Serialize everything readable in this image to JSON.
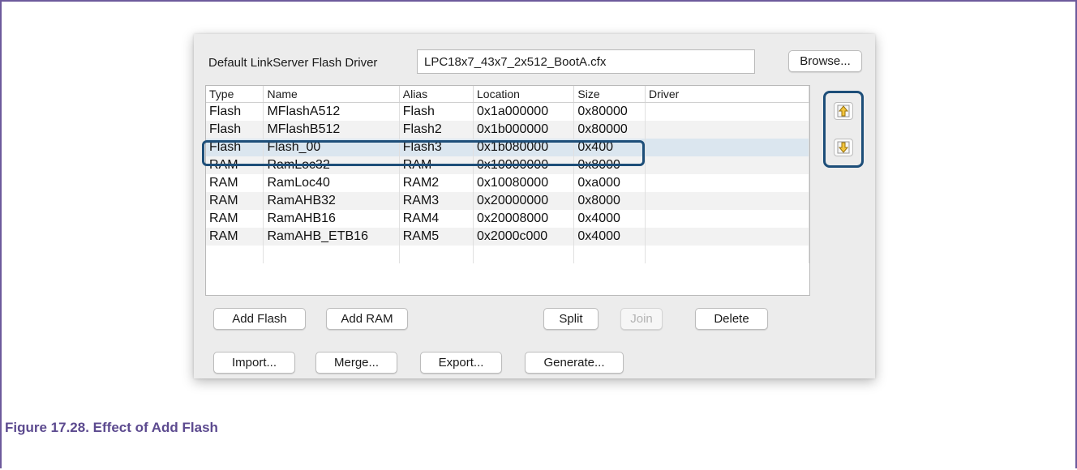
{
  "dialog": {
    "driver_label": "Default LinkServer Flash Driver",
    "driver_value": "LPC18x7_43x7_2x512_BootA.cfx",
    "browse_label": "Browse..."
  },
  "table": {
    "headers": [
      "Type",
      "Name",
      "Alias",
      "Location",
      "Size",
      "Driver"
    ],
    "rows": [
      {
        "type": "Flash",
        "name": "MFlashA512",
        "alias": "Flash",
        "location": "0x1a000000",
        "size": "0x80000",
        "driver": ""
      },
      {
        "type": "Flash",
        "name": "MFlashB512",
        "alias": "Flash2",
        "location": "0x1b000000",
        "size": "0x80000",
        "driver": ""
      },
      {
        "type": "Flash",
        "name": "Flash_00",
        "alias": "Flash3",
        "location": "0x1b080000",
        "size": "0x400",
        "driver": ""
      },
      {
        "type": "RAM",
        "name": "RamLoc32",
        "alias": "RAM",
        "location": "0x10000000",
        "size": "0x8000",
        "driver": ""
      },
      {
        "type": "RAM",
        "name": "RamLoc40",
        "alias": "RAM2",
        "location": "0x10080000",
        "size": "0xa000",
        "driver": ""
      },
      {
        "type": "RAM",
        "name": "RamAHB32",
        "alias": "RAM3",
        "location": "0x20000000",
        "size": "0x8000",
        "driver": ""
      },
      {
        "type": "RAM",
        "name": "RamAHB16",
        "alias": "RAM4",
        "location": "0x20008000",
        "size": "0x4000",
        "driver": ""
      },
      {
        "type": "RAM",
        "name": "RamAHB_ETB16",
        "alias": "RAM5",
        "location": "0x2000c000",
        "size": "0x4000",
        "driver": ""
      }
    ],
    "selected_row": 2
  },
  "buttons": {
    "add_flash": "Add Flash",
    "add_ram": "Add RAM",
    "split": "Split",
    "join": "Join",
    "delete": "Delete",
    "import": "Import...",
    "merge": "Merge...",
    "export": "Export...",
    "generate": "Generate..."
  },
  "icons": {
    "move_up": "arrow-up-icon",
    "move_down": "arrow-down-icon"
  },
  "caption": "Figure 17.28. Effect of Add Flash",
  "colors": {
    "caption": "#5c4a8f",
    "frame": "#6d5a9c",
    "highlight": "#1d4e79"
  }
}
